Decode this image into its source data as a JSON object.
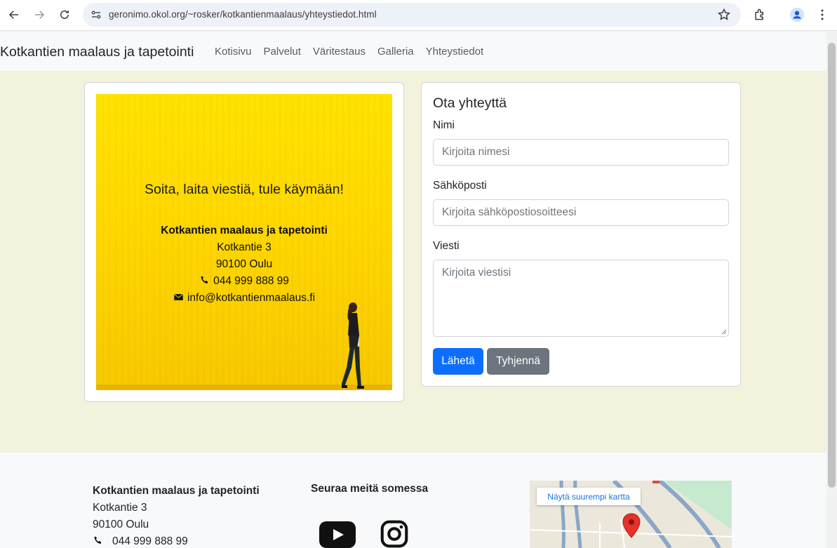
{
  "browser": {
    "url": "geronimo.okol.org/~rosker/kotkantienmaalaus/yhteystiedot.html"
  },
  "navbar": {
    "brand": "Kotkantien maalaus ja tapetointi",
    "links": [
      "Kotisivu",
      "Palvelut",
      "Väritestaus",
      "Galleria",
      "Yhteystiedot"
    ]
  },
  "hero": {
    "title": "Soita, laita viestiä, tule käymään!",
    "company": "Kotkantien maalaus ja tapetointi",
    "street": "Kotkantie 3",
    "city": "90100 Oulu",
    "phone": "044 999 888 99",
    "email": "info@kotkantienmaalaus.fi",
    "icons": [
      "phone-icon",
      "envelope-icon"
    ],
    "background_color": "#ffdd00"
  },
  "form": {
    "title": "Ota yhteyttä",
    "name_label": "Nimi",
    "name_placeholder": "Kirjoita nimesi",
    "email_label": "Sähköposti",
    "email_placeholder": "Kirjoita sähköpostiosoitteesi",
    "message_label": "Viesti",
    "message_placeholder": "Kirjoita viestisi",
    "submit_label": "Lähetä",
    "reset_label": "Tyhjennä"
  },
  "footer": {
    "company": "Kotkantien maalaus ja tapetointi",
    "street": "Kotkantie 3",
    "city": "90100 Oulu",
    "phone": "044 999 888 99",
    "social_title": "Seuraa meitä somessa",
    "social_icons": [
      "youtube-icon",
      "instagram-icon"
    ],
    "map_link": "Näytä suurempi kartta"
  },
  "colors": {
    "page_bg": "#f2f2dd",
    "primary": "#0d6efd",
    "secondary": "#6c757d"
  }
}
